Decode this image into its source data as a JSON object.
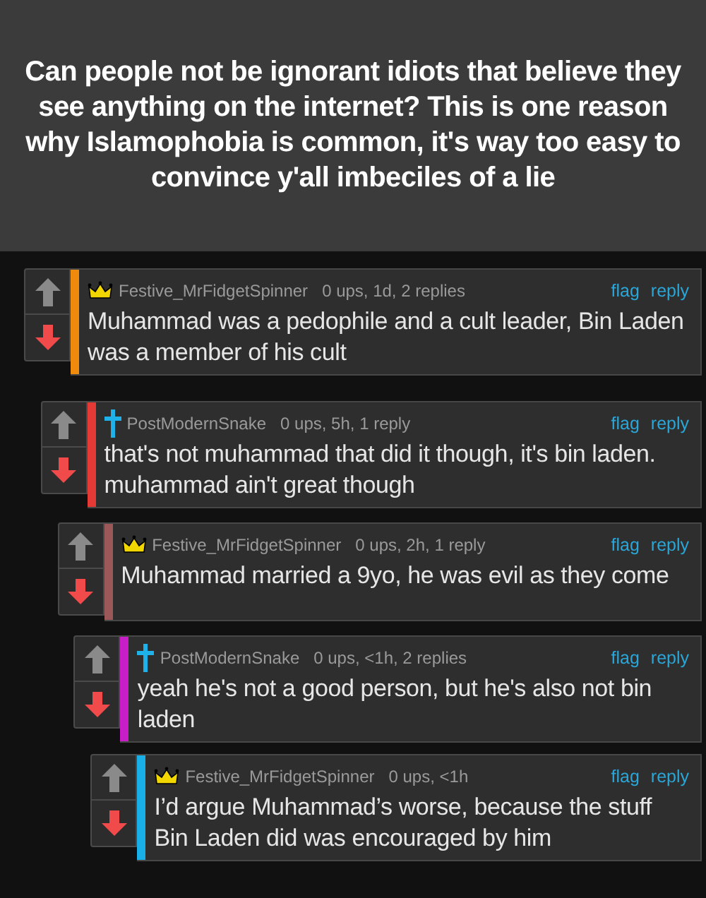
{
  "caption": "Can people not be ignorant idiots that believe they see anything on the internet? This is one reason why Islamophobia is common, it's way too easy to convince y'all imbeciles of a lie",
  "comments": [
    {
      "user": "Festive_MrFidgetSpinner",
      "kind": "crown",
      "meta": "0 ups, 1d, 2 replies",
      "flag": "flag",
      "reply": "reply",
      "color": "#f08a0c",
      "text": "Muhammad was a pedophile and a cult leader, Bin Laden was a member of his cult",
      "children": [
        {
          "user": "PostModernSnake",
          "kind": "cross",
          "meta": "0 ups, 5h, 1 reply",
          "flag": "flag",
          "reply": "reply",
          "color": "#e53935",
          "text": "that's not muhammad that did it though, it's bin laden. muhammad ain't great though",
          "children": [
            {
              "user": "Festive_MrFidgetSpinner",
              "kind": "crown",
              "meta": "0 ups, 2h, 1 reply",
              "flag": "flag",
              "reply": "reply",
              "color": "#9a5858",
              "text": "Muhammad married a 9yo, he was evil as they come",
              "children": [
                {
                  "user": "PostModernSnake",
                  "kind": "cross",
                  "meta": "0 ups, <1h, 2 replies",
                  "flag": "flag",
                  "reply": "reply",
                  "color": "#c81ec8",
                  "text": "yeah he's not a good person, but he's also not bin laden",
                  "children": [
                    {
                      "user": "Festive_MrFidgetSpinner",
                      "kind": "crown",
                      "meta": "0 ups, <1h",
                      "flag": "flag",
                      "reply": "reply",
                      "color": "#18b0e6",
                      "text": "I’d argue Muhammad’s worse, because the stuff Bin Laden did was encouraged by him"
                    }
                  ]
                }
              ]
            }
          ]
        }
      ]
    }
  ]
}
